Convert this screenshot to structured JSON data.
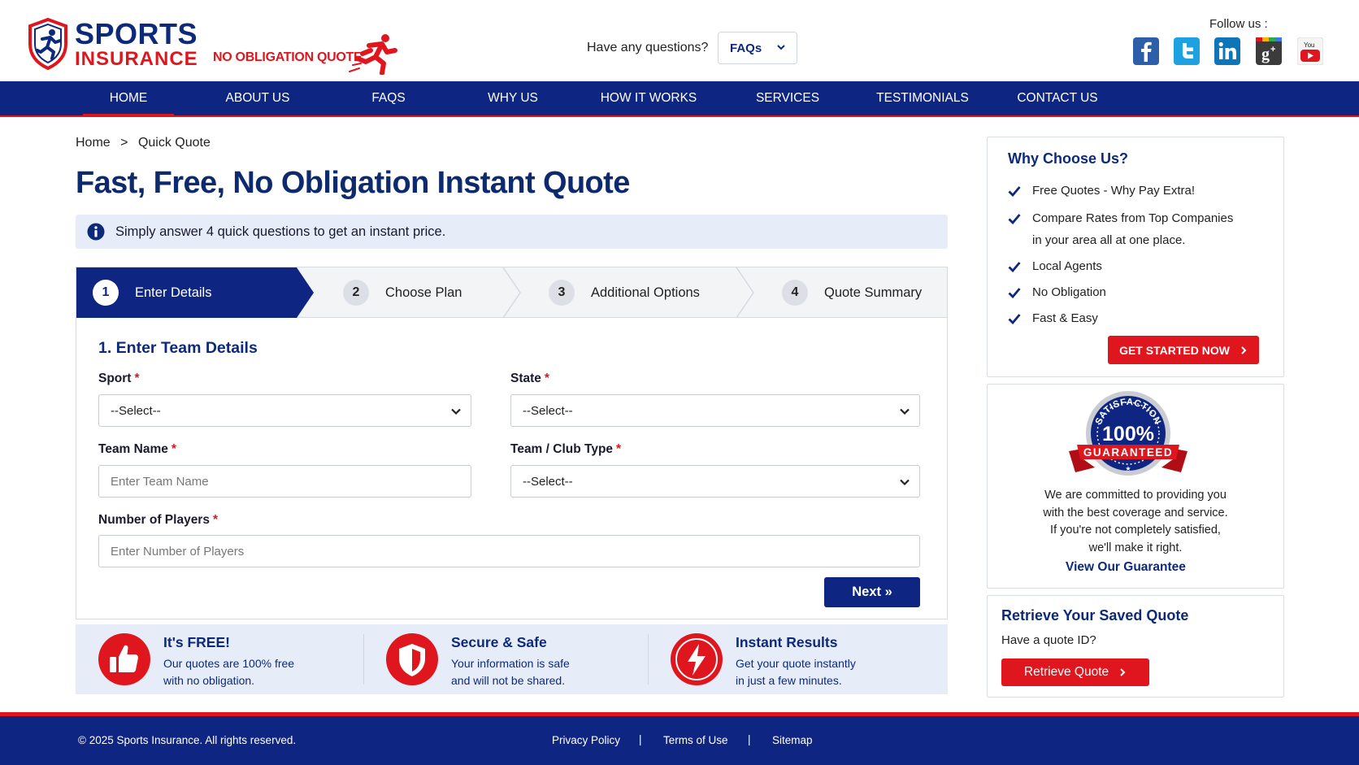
{
  "brand": {
    "line1": "SPORTS",
    "line2": "INSURANCE",
    "tagline": "NO OBLIGATION QUOTE",
    "primary_color": "#0f2582",
    "accent_color": "#e0161e"
  },
  "header": {
    "questions_text": "Have any questions?",
    "faq_dropdown_value": "FAQs",
    "follow_text": "Follow us :",
    "social_icons": [
      "facebook-icon",
      "twitter-icon",
      "linkedin-icon",
      "google-plus-icon",
      "youtube-icon"
    ]
  },
  "nav": {
    "items": [
      {
        "label": "HOME",
        "active": true
      },
      {
        "label": "ABOUT US"
      },
      {
        "label": "FAQS"
      },
      {
        "label": "WHY US"
      },
      {
        "label": "HOW IT WORKS"
      },
      {
        "label": "SERVICES"
      },
      {
        "label": "TESTIMONIALS"
      },
      {
        "label": "CONTACT US"
      }
    ]
  },
  "breadcrumb": {
    "home": "Home",
    "separator": ">",
    "current": "Quick Quote"
  },
  "page": {
    "title": "Fast, Free, No Obligation Instant Quote",
    "info_text": "Simply answer 4 quick questions to get an instant price."
  },
  "steps": [
    {
      "num": "1",
      "label": "Enter Details",
      "active": true
    },
    {
      "num": "2",
      "label": "Choose Plan"
    },
    {
      "num": "3",
      "label": "Additional Options"
    },
    {
      "num": "4",
      "label": "Quote Summary"
    }
  ],
  "form": {
    "section_title": "1. Enter Team Details",
    "required_mark": "*",
    "sport": {
      "label": "Sport",
      "value": "--Select--"
    },
    "state": {
      "label": "State",
      "value": "--Select--"
    },
    "team_name": {
      "label": "Team Name",
      "placeholder": "Enter Team Name"
    },
    "club_type": {
      "label": "Team / Club Type",
      "value": "--Select--"
    },
    "players": {
      "label": "Number of Players",
      "placeholder": "Enter Number of Players"
    },
    "next_label": "Next »"
  },
  "features": [
    {
      "icon": "thumbs-up-icon",
      "title": "It's FREE!",
      "line1": "Our quotes are 100% free",
      "line2": "with no obligation."
    },
    {
      "icon": "shield-icon",
      "title": "Secure & Safe",
      "line1": "Your information is safe",
      "line2": "and will not be shared."
    },
    {
      "icon": "lightning-icon",
      "title": "Instant Results",
      "line1": "Get your quote instantly",
      "line2": "in just a few minutes."
    }
  ],
  "sidebar": {
    "why": {
      "title": "Why Choose Us?",
      "items": [
        "Free Quotes - Why Pay Extra!",
        "Compare Rates from Top Companies",
        "Local Agents",
        "No Obligation",
        "Fast & Easy"
      ],
      "item2_cont": "in your area all at one place.",
      "cta": "GET STARTED NOW"
    },
    "guarantee": {
      "badge_top": "SATISFACTION",
      "badge_pct": "100%",
      "badge_ribbon": "GUARANTEED",
      "line1": "We are committed to providing you",
      "line2": "with the best coverage and service.",
      "line3": "If you're not completely satisfied,",
      "line4": "we'll make it right.",
      "link": "View Our Guarantee"
    },
    "retrieve": {
      "title": "Retrieve Your Saved Quote",
      "subtitle": "Have a quote ID?",
      "button": "Retrieve Quote"
    }
  },
  "footer": {
    "copyright": "© 2025 Sports Insurance. All rights reserved.",
    "links": [
      "Privacy Policy",
      "Terms of Use",
      "Sitemap"
    ],
    "separator": "|"
  }
}
